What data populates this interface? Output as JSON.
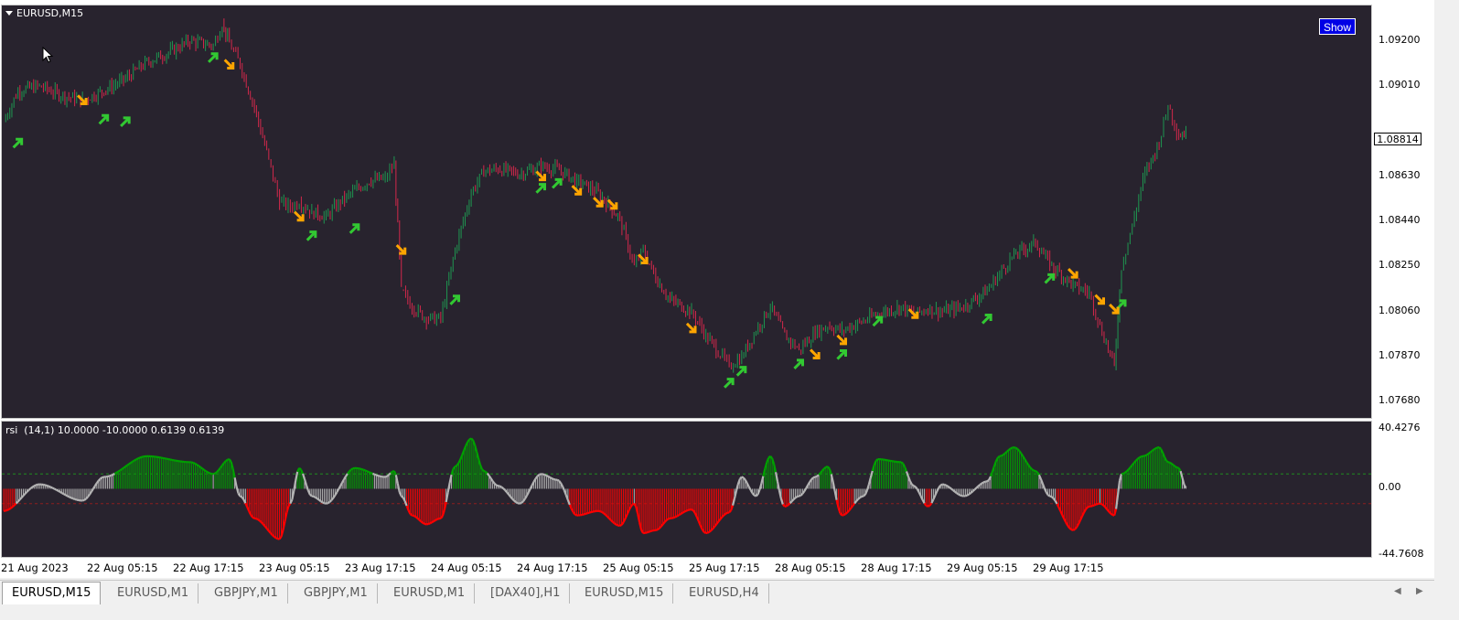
{
  "window": {
    "symbol_title": "EURUSD,M15",
    "show_button": "Show",
    "current_price": "1.08814"
  },
  "price_axis": {
    "labels": [
      "1.09200",
      "1.09010",
      "1.08630",
      "1.08440",
      "1.08250",
      "1.08060",
      "1.07870",
      "1.07680"
    ]
  },
  "indicator": {
    "title": "rsi  (14,1) 10.0000 -10.0000 0.6139 0.6139",
    "axis_labels": [
      "40.4276",
      "0.00",
      "-44.7608"
    ],
    "upper_level": 10,
    "lower_level": -10,
    "range": [
      -44.7608,
      40.4276
    ],
    "colors": {
      "positive": "#00a000",
      "negative": "#ff0000",
      "neutral": "#b4b4b4"
    }
  },
  "time_axis": {
    "labels": [
      "21 Aug 2023",
      "22 Aug 05:15",
      "22 Aug 17:15",
      "23 Aug 05:15",
      "23 Aug 17:15",
      "24 Aug 05:15",
      "24 Aug 17:15",
      "25 Aug 05:15",
      "25 Aug 17:15",
      "28 Aug 05:15",
      "28 Aug 17:15",
      "29 Aug 05:15",
      "29 Aug 17:15"
    ]
  },
  "tabs": [
    {
      "label": "EURUSD,M15",
      "active": true
    },
    {
      "label": "EURUSD,M1"
    },
    {
      "label": "GBPJPY,M1"
    },
    {
      "label": "GBPJPY,M1"
    },
    {
      "label": "EURUSD,M1"
    },
    {
      "label": "[DAX40],H1"
    },
    {
      "label": "EURUSD,M15"
    },
    {
      "label": "EURUSD,H4"
    }
  ],
  "chart_data": {
    "type": "line",
    "title": "EURUSD,M15",
    "y_range": [
      1.0762,
      1.0931
    ],
    "colors": {
      "bull": "#1e9650",
      "bear": "#d2284b",
      "buy_arrow": "#32c832",
      "sell_arrow": "#ffa500"
    },
    "close_series": [
      {
        "t": "21 Aug 2023",
        "v": 1.0886
      },
      {
        "t": "21 Aug 02:00",
        "v": 1.0899
      },
      {
        "t": "21 Aug 05:00",
        "v": 1.0901
      },
      {
        "t": "21 Aug 08:00",
        "v": 1.0897
      },
      {
        "t": "21 Aug 11:00",
        "v": 1.0895
      },
      {
        "t": "21 Aug 14:00",
        "v": 1.0899
      },
      {
        "t": "21 Aug 17:00",
        "v": 1.0904
      },
      {
        "t": "21 Aug 20:00",
        "v": 1.0911
      },
      {
        "t": "21 Aug 23:00",
        "v": 1.0915
      },
      {
        "t": "22 Aug 02:00",
        "v": 1.092
      },
      {
        "t": "22 Aug 05:15",
        "v": 1.0918
      },
      {
        "t": "22 Aug 06:30",
        "v": 1.0927
      },
      {
        "t": "22 Aug 07:30",
        "v": 1.0919
      },
      {
        "t": "22 Aug 09:00",
        "v": 1.091
      },
      {
        "t": "22 Aug 11:00",
        "v": 1.0892
      },
      {
        "t": "22 Aug 13:00",
        "v": 1.087
      },
      {
        "t": "22 Aug 14:30",
        "v": 1.0852
      },
      {
        "t": "22 Aug 16:00",
        "v": 1.085
      },
      {
        "t": "22 Aug 17:15",
        "v": 1.0852
      },
      {
        "t": "22 Aug 19:00",
        "v": 1.0848
      },
      {
        "t": "22 Aug 21:00",
        "v": 1.0846
      },
      {
        "t": "22 Aug 23:00",
        "v": 1.0852
      },
      {
        "t": "23 Aug 01:00",
        "v": 1.0857
      },
      {
        "t": "23 Aug 03:00",
        "v": 1.0861
      },
      {
        "t": "23 Aug 05:15",
        "v": 1.0862
      },
      {
        "t": "23 Aug 06:30",
        "v": 1.0868
      },
      {
        "t": "23 Aug 07:30",
        "v": 1.0815
      },
      {
        "t": "23 Aug 09:00",
        "v": 1.0808
      },
      {
        "t": "23 Aug 11:00",
        "v": 1.0803
      },
      {
        "t": "23 Aug 13:00",
        "v": 1.0803
      },
      {
        "t": "23 Aug 15:00",
        "v": 1.0832
      },
      {
        "t": "23 Aug 17:15",
        "v": 1.0856
      },
      {
        "t": "23 Aug 19:00",
        "v": 1.0865
      },
      {
        "t": "23 Aug 21:00",
        "v": 1.0866
      },
      {
        "t": "24 Aug 00:00",
        "v": 1.0864
      },
      {
        "t": "24 Aug 03:00",
        "v": 1.0867
      },
      {
        "t": "24 Aug 05:15",
        "v": 1.0866
      },
      {
        "t": "24 Aug 08:00",
        "v": 1.0861
      },
      {
        "t": "24 Aug 11:00",
        "v": 1.0856
      },
      {
        "t": "24 Aug 14:00",
        "v": 1.0845
      },
      {
        "t": "24 Aug 16:00",
        "v": 1.0825
      },
      {
        "t": "24 Aug 17:15",
        "v": 1.0832
      },
      {
        "t": "24 Aug 19:00",
        "v": 1.082
      },
      {
        "t": "24 Aug 21:00",
        "v": 1.0811
      },
      {
        "t": "25 Aug 00:00",
        "v": 1.0806
      },
      {
        "t": "25 Aug 02:00",
        "v": 1.0796
      },
      {
        "t": "25 Aug 04:00",
        "v": 1.0788
      },
      {
        "t": "25 Aug 05:15",
        "v": 1.0783
      },
      {
        "t": "25 Aug 07:00",
        "v": 1.0787
      },
      {
        "t": "25 Aug 09:00",
        "v": 1.0798
      },
      {
        "t": "25 Aug 11:00",
        "v": 1.0808
      },
      {
        "t": "25 Aug 13:00",
        "v": 1.0796
      },
      {
        "t": "25 Aug 15:00",
        "v": 1.079
      },
      {
        "t": "25 Aug 17:15",
        "v": 1.0797
      },
      {
        "t": "25 Aug 19:00",
        "v": 1.08
      },
      {
        "t": "25 Aug 21:00",
        "v": 1.0798
      },
      {
        "t": "28 Aug 00:00",
        "v": 1.0802
      },
      {
        "t": "28 Aug 02:00",
        "v": 1.0805
      },
      {
        "t": "28 Aug 05:15",
        "v": 1.0808
      },
      {
        "t": "28 Aug 07:00",
        "v": 1.0805
      },
      {
        "t": "28 Aug 09:00",
        "v": 1.0807
      },
      {
        "t": "28 Aug 11:00",
        "v": 1.0806
      },
      {
        "t": "28 Aug 14:00",
        "v": 1.0808
      },
      {
        "t": "28 Aug 17:15",
        "v": 1.0815
      },
      {
        "t": "28 Aug 19:00",
        "v": 1.0822
      },
      {
        "t": "28 Aug 21:00",
        "v": 1.083
      },
      {
        "t": "29 Aug 00:00",
        "v": 1.0835
      },
      {
        "t": "29 Aug 02:00",
        "v": 1.0826
      },
      {
        "t": "29 Aug 05:15",
        "v": 1.0817
      },
      {
        "t": "29 Aug 07:30",
        "v": 1.0814
      },
      {
        "t": "29 Aug 09:00",
        "v": 1.08
      },
      {
        "t": "29 Aug 11:00",
        "v": 1.0783
      },
      {
        "t": "29 Aug 12:00",
        "v": 1.0825
      },
      {
        "t": "29 Aug 13:30",
        "v": 1.0842
      },
      {
        "t": "29 Aug 15:00",
        "v": 1.0862
      },
      {
        "t": "29 Aug 17:15",
        "v": 1.0877
      },
      {
        "t": "29 Aug 18:30",
        "v": 1.0893
      },
      {
        "t": "29 Aug 20:00",
        "v": 1.088
      },
      {
        "t": "29 Aug 21:00",
        "v": 1.08814
      }
    ],
    "buy_signals": [
      {
        "t": "21 Aug 02:00",
        "v": 1.0877
      },
      {
        "t": "21 Aug 14:00",
        "v": 1.0887
      },
      {
        "t": "21 Aug 17:00",
        "v": 1.0886
      },
      {
        "t": "22 Aug 05:15",
        "v": 1.0913
      },
      {
        "t": "22 Aug 19:00",
        "v": 1.0838
      },
      {
        "t": "23 Aug 01:00",
        "v": 1.0841
      },
      {
        "t": "23 Aug 15:00",
        "v": 1.0811
      },
      {
        "t": "24 Aug 03:00",
        "v": 1.0858
      },
      {
        "t": "24 Aug 05:15",
        "v": 1.086
      },
      {
        "t": "25 Aug 05:15",
        "v": 1.0776
      },
      {
        "t": "25 Aug 07:00",
        "v": 1.0781
      },
      {
        "t": "25 Aug 15:00",
        "v": 1.0784
      },
      {
        "t": "25 Aug 21:00",
        "v": 1.0788
      },
      {
        "t": "28 Aug 02:00",
        "v": 1.0802
      },
      {
        "t": "28 Aug 17:15",
        "v": 1.0803
      },
      {
        "t": "29 Aug 02:00",
        "v": 1.082
      },
      {
        "t": "29 Aug 12:00",
        "v": 1.0809
      }
    ],
    "sell_signals": [
      {
        "t": "21 Aug 11:00",
        "v": 1.0895
      },
      {
        "t": "22 Aug 07:30",
        "v": 1.091
      },
      {
        "t": "22 Aug 17:15",
        "v": 1.0846
      },
      {
        "t": "23 Aug 07:30",
        "v": 1.0832
      },
      {
        "t": "24 Aug 03:00",
        "v": 1.0863
      },
      {
        "t": "24 Aug 08:00",
        "v": 1.0857
      },
      {
        "t": "24 Aug 11:00",
        "v": 1.0852
      },
      {
        "t": "24 Aug 13:00",
        "v": 1.0851
      },
      {
        "t": "24 Aug 17:15",
        "v": 1.0828
      },
      {
        "t": "25 Aug 00:00",
        "v": 1.0799
      },
      {
        "t": "25 Aug 17:15",
        "v": 1.0788
      },
      {
        "t": "25 Aug 21:00",
        "v": 1.0794
      },
      {
        "t": "28 Aug 07:00",
        "v": 1.0805
      },
      {
        "t": "29 Aug 05:15",
        "v": 1.0822
      },
      {
        "t": "29 Aug 09:00",
        "v": 1.0811
      },
      {
        "t": "29 Aug 11:00",
        "v": 1.0807
      }
    ],
    "indicator_series": [
      {
        "t": "21 Aug 2023",
        "v": -15
      },
      {
        "t": "21 Aug 05:00",
        "v": 3
      },
      {
        "t": "21 Aug 11:00",
        "v": -8
      },
      {
        "t": "21 Aug 14:00",
        "v": 8
      },
      {
        "t": "21 Aug 20:00",
        "v": 22
      },
      {
        "t": "22 Aug 02:00",
        "v": 18
      },
      {
        "t": "22 Aug 05:15",
        "v": 10
      },
      {
        "t": "22 Aug 07:30",
        "v": 20
      },
      {
        "t": "22 Aug 09:00",
        "v": -5
      },
      {
        "t": "22 Aug 11:00",
        "v": -20
      },
      {
        "t": "22 Aug 14:30",
        "v": -34
      },
      {
        "t": "22 Aug 16:00",
        "v": -10
      },
      {
        "t": "22 Aug 17:15",
        "v": 14
      },
      {
        "t": "22 Aug 19:00",
        "v": -5
      },
      {
        "t": "22 Aug 21:00",
        "v": -10
      },
      {
        "t": "23 Aug 01:00",
        "v": 14
      },
      {
        "t": "23 Aug 05:15",
        "v": 8
      },
      {
        "t": "23 Aug 06:30",
        "v": 12
      },
      {
        "t": "23 Aug 07:30",
        "v": -5
      },
      {
        "t": "23 Aug 09:00",
        "v": -18
      },
      {
        "t": "23 Aug 11:00",
        "v": -24
      },
      {
        "t": "23 Aug 13:00",
        "v": -20
      },
      {
        "t": "23 Aug 15:00",
        "v": 15
      },
      {
        "t": "23 Aug 17:15",
        "v": 34
      },
      {
        "t": "23 Aug 19:00",
        "v": 12
      },
      {
        "t": "23 Aug 21:00",
        "v": 2
      },
      {
        "t": "24 Aug 00:00",
        "v": -10
      },
      {
        "t": "24 Aug 03:00",
        "v": 10
      },
      {
        "t": "24 Aug 05:15",
        "v": 6
      },
      {
        "t": "24 Aug 08:00",
        "v": -18
      },
      {
        "t": "24 Aug 11:00",
        "v": -15
      },
      {
        "t": "24 Aug 14:00",
        "v": -25
      },
      {
        "t": "24 Aug 16:00",
        "v": -10
      },
      {
        "t": "24 Aug 17:15",
        "v": -30
      },
      {
        "t": "24 Aug 19:00",
        "v": -28
      },
      {
        "t": "24 Aug 21:00",
        "v": -20
      },
      {
        "t": "25 Aug 00:00",
        "v": -14
      },
      {
        "t": "25 Aug 02:00",
        "v": -30
      },
      {
        "t": "25 Aug 05:15",
        "v": -16
      },
      {
        "t": "25 Aug 07:00",
        "v": 8
      },
      {
        "t": "25 Aug 09:00",
        "v": -5
      },
      {
        "t": "25 Aug 11:00",
        "v": 22
      },
      {
        "t": "25 Aug 13:00",
        "v": -12
      },
      {
        "t": "25 Aug 15:00",
        "v": -5
      },
      {
        "t": "25 Aug 17:15",
        "v": 8
      },
      {
        "t": "25 Aug 19:00",
        "v": 15
      },
      {
        "t": "25 Aug 21:00",
        "v": -18
      },
      {
        "t": "28 Aug 00:00",
        "v": -5
      },
      {
        "t": "28 Aug 02:00",
        "v": 20
      },
      {
        "t": "28 Aug 05:15",
        "v": 18
      },
      {
        "t": "28 Aug 07:00",
        "v": 2
      },
      {
        "t": "28 Aug 09:00",
        "v": -12
      },
      {
        "t": "28 Aug 11:00",
        "v": 3
      },
      {
        "t": "28 Aug 14:00",
        "v": -5
      },
      {
        "t": "28 Aug 17:15",
        "v": 5
      },
      {
        "t": "28 Aug 19:00",
        "v": 22
      },
      {
        "t": "28 Aug 21:00",
        "v": 28
      },
      {
        "t": "29 Aug 00:00",
        "v": 12
      },
      {
        "t": "29 Aug 02:00",
        "v": -5
      },
      {
        "t": "29 Aug 05:15",
        "v": -28
      },
      {
        "t": "29 Aug 07:30",
        "v": -12
      },
      {
        "t": "29 Aug 09:00",
        "v": -10
      },
      {
        "t": "29 Aug 11:00",
        "v": -18
      },
      {
        "t": "29 Aug 12:00",
        "v": 10
      },
      {
        "t": "29 Aug 15:00",
        "v": 22
      },
      {
        "t": "29 Aug 17:15",
        "v": 28
      },
      {
        "t": "29 Aug 18:30",
        "v": 18
      },
      {
        "t": "29 Aug 20:00",
        "v": 14
      },
      {
        "t": "29 Aug 21:00",
        "v": 0.6139
      }
    ]
  }
}
